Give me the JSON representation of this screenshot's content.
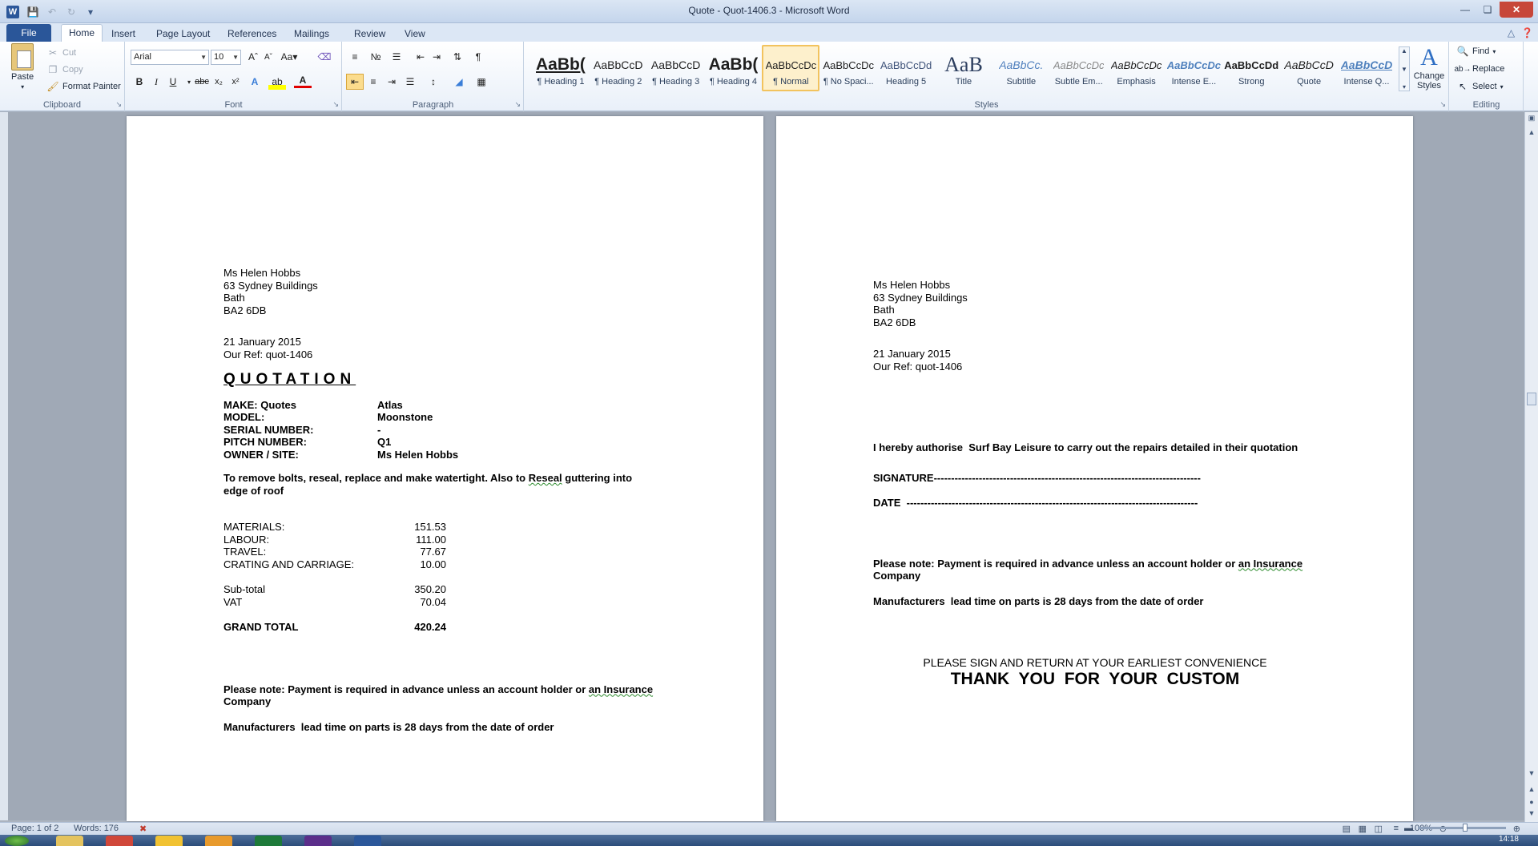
{
  "window": {
    "title": "Quote - Quot-1406.3  -  Microsoft Word",
    "app_icon_letter": "W"
  },
  "tabs": [
    "File",
    "Home",
    "Insert",
    "Page Layout",
    "References",
    "Mailings",
    "Review",
    "View"
  ],
  "active_tab": "Home",
  "ribbon": {
    "clipboard": {
      "paste": "Paste",
      "cut": "Cut",
      "copy": "Copy",
      "format_painter": "Format Painter",
      "label": "Clipboard"
    },
    "font": {
      "font_name": "Arial",
      "font_size": "10",
      "label": "Font"
    },
    "paragraph": {
      "label": "Paragraph"
    },
    "styles": {
      "label": "Styles",
      "items": [
        {
          "sample": "AaBb(",
          "label": "¶ Heading 1"
        },
        {
          "sample": "AaBbCcD",
          "label": "¶ Heading 2"
        },
        {
          "sample": "AaBbCcD",
          "label": "¶ Heading 3"
        },
        {
          "sample": "AaBb(",
          "label": "¶ Heading 4"
        },
        {
          "sample": "AaBbCcDc",
          "label": "¶ Normal"
        },
        {
          "sample": "AaBbCcDc",
          "label": "¶ No Spaci..."
        },
        {
          "sample": "AaBbCcDd",
          "label": "Heading 5"
        },
        {
          "sample": "AaB",
          "label": "Title"
        },
        {
          "sample": "AaBbCc.",
          "label": "Subtitle"
        },
        {
          "sample": "AaBbCcDc",
          "label": "Subtle Em..."
        },
        {
          "sample": "AaBbCcDc",
          "label": "Emphasis"
        },
        {
          "sample": "AaBbCcDc",
          "label": "Intense E..."
        },
        {
          "sample": "AaBbCcDd",
          "label": "Strong"
        },
        {
          "sample": "AaBbCcD",
          "label": "Quote"
        },
        {
          "sample": "AaBbCcD",
          "label": "Intense Q..."
        }
      ],
      "selected": "¶ Normal",
      "change_styles": "Change Styles"
    },
    "editing": {
      "find": "Find",
      "replace": "Replace",
      "select": "Select",
      "label": "Editing"
    }
  },
  "page1": {
    "address": [
      "Ms Helen Hobbs",
      "63 Sydney Buildings",
      "Bath",
      "BA2 6DB"
    ],
    "date": "21 January 2015",
    "ref": "Our Ref: quot-1406",
    "heading": "QUOTATION",
    "details": [
      {
        "k": "MAKE: Quotes",
        "v": "Atlas"
      },
      {
        "k": "MODEL:",
        "v": "Moonstone"
      },
      {
        "k": "SERIAL NUMBER:",
        "v": "-"
      },
      {
        "k": "PITCH NUMBER:",
        "v": "Q1"
      },
      {
        "k": "OWNER / SITE:",
        "v": "Ms Helen Hobbs"
      }
    ],
    "description_a": "To remove bolts, reseal, replace and make watertight.  Also to ",
    "description_b": "Reseal",
    "description_c": " guttering into edge of roof",
    "costs": [
      {
        "k": "MATERIALS:",
        "v": "151.53"
      },
      {
        "k": "LABOUR:",
        "v": "111.00"
      },
      {
        "k": "TRAVEL:",
        "v": "77.67"
      },
      {
        "k": "CRATING  AND CARRIAGE:",
        "v": "10.00"
      }
    ],
    "subtotals": [
      {
        "k": "Sub-total",
        "v": "350.20"
      },
      {
        "k": "VAT",
        "v": "70.04"
      }
    ],
    "grand_total": {
      "k": "GRAND  TOTAL",
      "v": "420.24"
    },
    "note_a": "Please note:  Payment is required in advance unless an account holder or ",
    "note_b": "an Insurance",
    "note_c": "Company",
    "lead_time": "Manufacturers  lead time on parts is 28 days from the date of order"
  },
  "page2": {
    "address": [
      "Ms Helen Hobbs",
      "63 Sydney Buildings",
      "Bath",
      "BA2 6DB"
    ],
    "date": "21 January 2015",
    "ref": "Our Ref: quot-1406",
    "authorise": "I hereby authorise  Surf Bay Leisure to carry out the repairs detailed in their quotation",
    "signature": "SIGNATURE-----------------------------------------------------------------------------",
    "date_line": "DATE  ------------------------------------------------------------------------------------",
    "note_a": "Please note:  Payment is required in advance unless an account holder or ",
    "note_b": "an Insurance",
    "note_c": "Company",
    "lead_time": "Manufacturers  lead time on parts is 28 days from the date of order",
    "sign_return": "PLEASE SIGN AND RETURN AT YOUR EARLIEST CONVENIENCE",
    "thank_you": "THANK  YOU  FOR  YOUR  CUSTOM"
  },
  "status": {
    "page": "Page: 1 of 2",
    "words": "Words: 176",
    "zoom": "100%"
  },
  "taskbar": {
    "clock": "14:18"
  },
  "colors": {
    "file_tab": "#2a5699",
    "selected_style": "#f2c35e",
    "close_button": "#c7473a"
  }
}
